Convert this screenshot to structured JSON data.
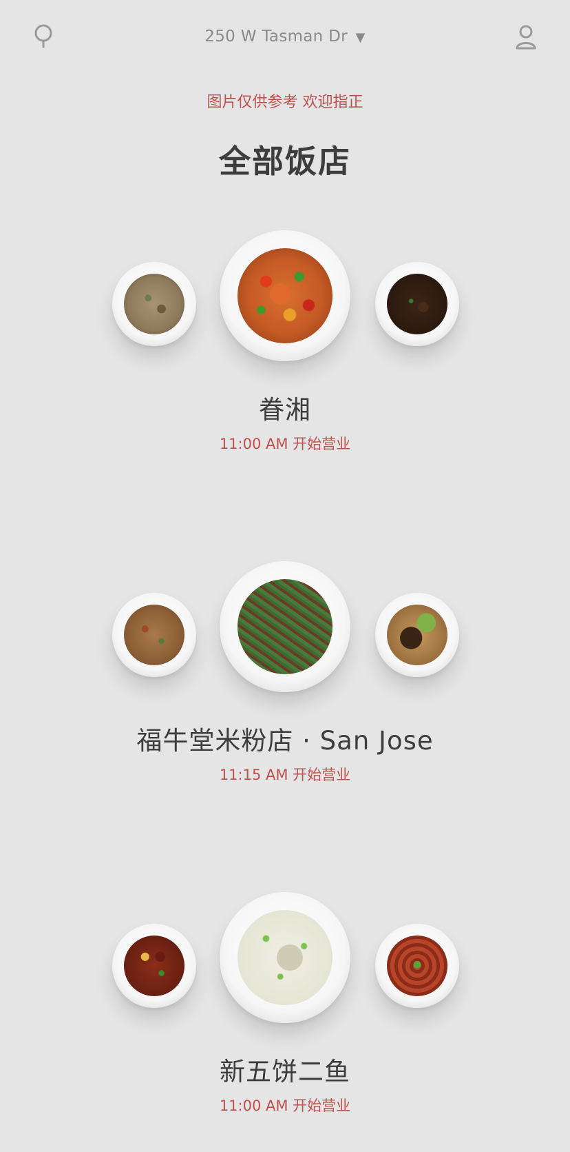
{
  "header": {
    "address": "250 W Tasman Dr",
    "address_caret": "▼",
    "search_icon": "search-icon",
    "profile_icon": "user-icon"
  },
  "disclaimer": "图片仅供参考 欢迎指正",
  "page_title": "全部饭店",
  "colors": {
    "background": "#e5e5e5",
    "accent": "#c0504d",
    "text": "#3d3d3d",
    "muted": "#8a8a8a"
  },
  "restaurants": [
    {
      "name": "眷湘",
      "hours": "11:00 AM 开始营业"
    },
    {
      "name": "福牛堂米粉店 · San Jose",
      "hours": "11:15 AM 开始营业"
    },
    {
      "name": "新五饼二鱼",
      "hours": "11:00 AM 开始营业"
    }
  ]
}
